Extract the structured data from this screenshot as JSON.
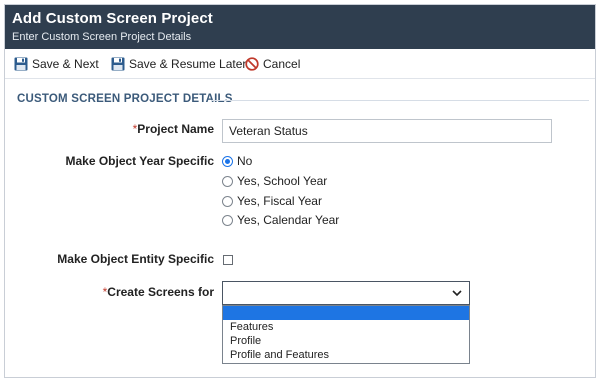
{
  "header": {
    "title": "Add Custom Screen Project",
    "subtitle": "Enter Custom Screen Project Details"
  },
  "toolbar": {
    "save_next_label": "Save & Next",
    "save_resume_label": "Save & Resume Later",
    "cancel_label": "Cancel"
  },
  "section": {
    "title": "CUSTOM SCREEN PROJECT DETAILS"
  },
  "form": {
    "project_name": {
      "required_mark": "*",
      "label": "Project Name",
      "value": "Veteran Status"
    },
    "year_specific": {
      "label": "Make Object Year Specific",
      "options": [
        "No",
        "Yes, School Year",
        "Yes, Fiscal Year",
        "Yes, Calendar Year"
      ],
      "selected": "No"
    },
    "entity_specific": {
      "label": "Make Object Entity Specific",
      "checked": false
    },
    "create_screens_for": {
      "required_mark": "*",
      "label": "Create Screens for",
      "value": "",
      "options": [
        "",
        "Features",
        "Profile",
        "Profile and Features"
      ],
      "highlighted": ""
    }
  },
  "colors": {
    "header_bg": "#2f3e4f",
    "section_title": "#3b5a7a",
    "accent": "#1a73e8",
    "dropdown_highlight": "#1e75e3",
    "required": "#c0392b"
  },
  "icons": {
    "save_next": "floppy-disk-icon",
    "save_resume": "floppy-disk-icon",
    "cancel": "prohibited-icon",
    "select": "chevron-down-icon"
  }
}
